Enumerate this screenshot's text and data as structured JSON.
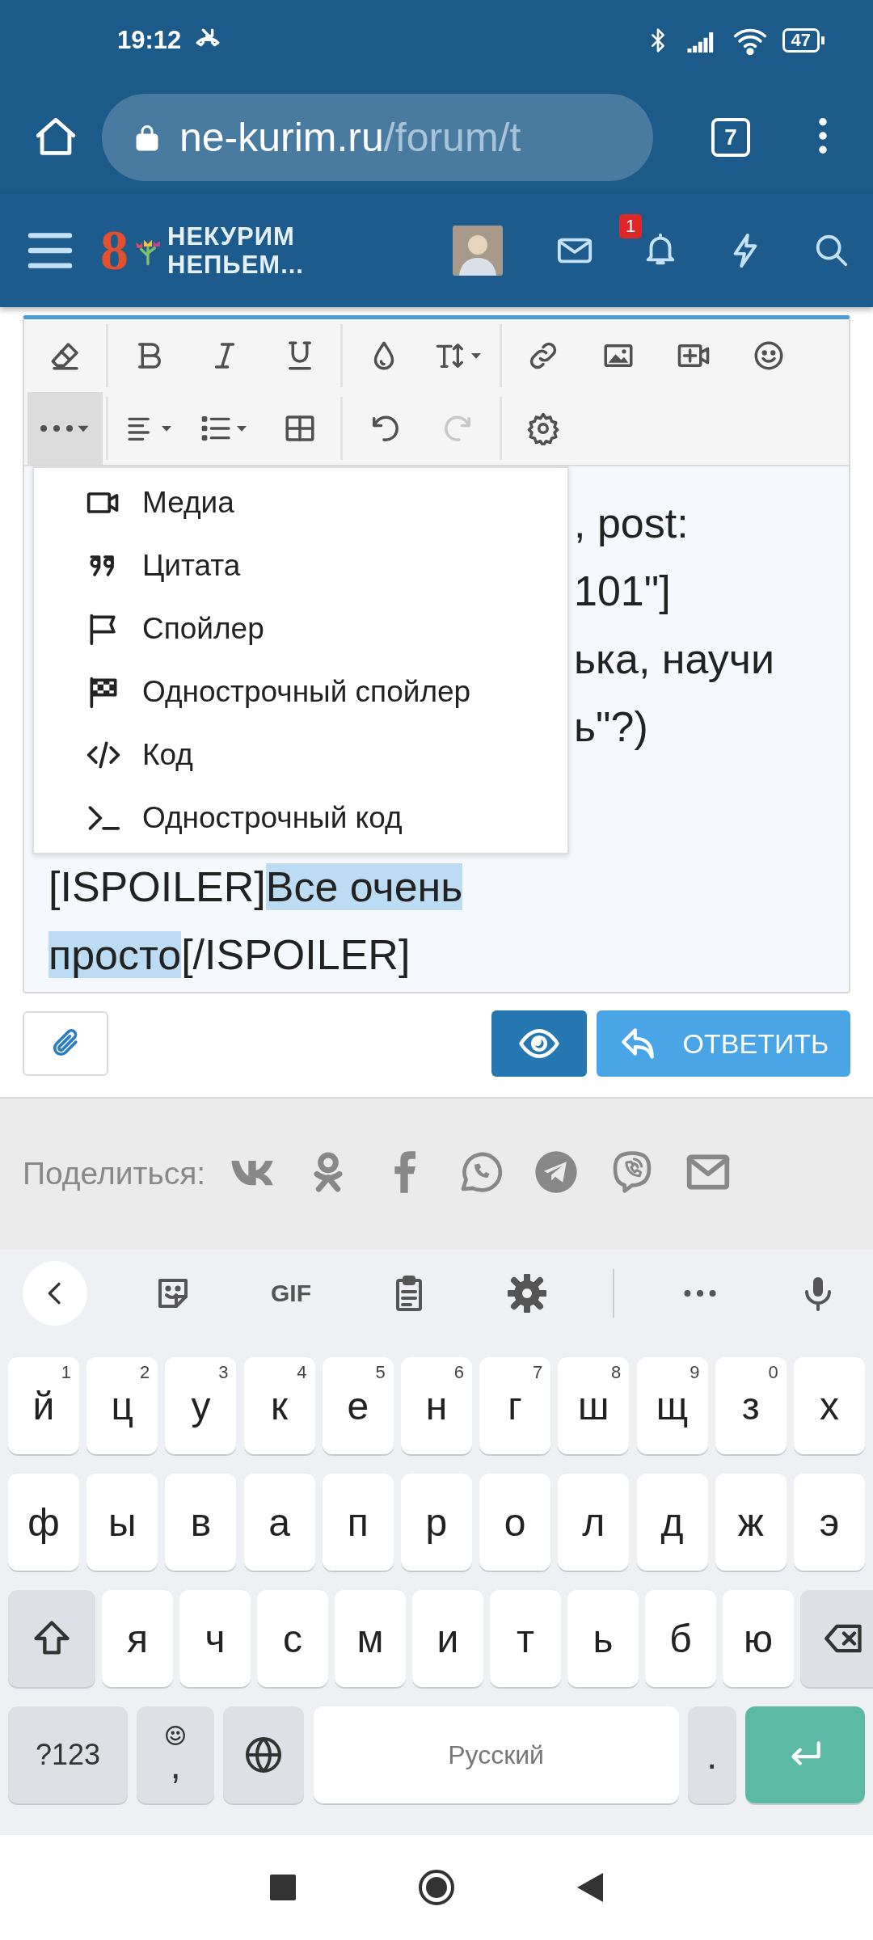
{
  "status_bar": {
    "time": "19:12",
    "battery": "47"
  },
  "browser": {
    "url_host": "ne-kurim.ru",
    "url_path": "/forum/t",
    "tab_count": "7"
  },
  "forum_header": {
    "logo_mark": "8",
    "logo_line1": "НЕКУРИМ",
    "logo_line2": "НЕПЬЕМ...",
    "notification_count": "1"
  },
  "editor": {
    "toolbar": [
      [
        [
          {
            "kind": "eraser",
            "active": false,
            "disabled": false
          }
        ],
        [
          {
            "kind": "bold",
            "active": false,
            "disabled": false
          },
          {
            "kind": "italic",
            "active": false,
            "disabled": false
          },
          {
            "kind": "underline",
            "active": false,
            "disabled": false
          }
        ],
        [
          {
            "kind": "color",
            "active": false,
            "disabled": false
          },
          {
            "kind": "size",
            "active": false,
            "disabled": false
          }
        ],
        [
          {
            "kind": "link",
            "active": false,
            "disabled": false
          },
          {
            "kind": "image",
            "active": false,
            "disabled": false
          },
          {
            "kind": "video",
            "active": false,
            "disabled": false
          },
          {
            "kind": "emoji",
            "active": false,
            "disabled": false
          }
        ]
      ],
      [
        [
          {
            "kind": "more",
            "active": true,
            "disabled": false
          }
        ],
        [
          {
            "kind": "align",
            "active": false,
            "disabled": false
          },
          {
            "kind": "list",
            "active": false,
            "disabled": false
          },
          {
            "kind": "table",
            "active": false,
            "disabled": false
          }
        ],
        [
          {
            "kind": "undo",
            "active": false,
            "disabled": false
          },
          {
            "kind": "redo",
            "active": false,
            "disabled": true
          }
        ],
        [
          {
            "kind": "settings",
            "active": false,
            "disabled": false
          }
        ]
      ]
    ],
    "menu": [
      {
        "kind": "media",
        "label": "Медиа"
      },
      {
        "kind": "quote",
        "label": "Цитата"
      },
      {
        "kind": "spoiler",
        "label": "Спойлер"
      },
      {
        "kind": "inline_spoiler",
        "label": "Однострочный спойлер"
      },
      {
        "kind": "code",
        "label": "Код"
      },
      {
        "kind": "inline_code",
        "label": "Однострочный код"
      }
    ],
    "lines": [
      {
        "kind": "partial",
        "segments": [
          {
            "text": ", post:",
            "selected": false
          }
        ]
      },
      {
        "kind": "partial",
        "segments": [
          {
            "text": "101\"]",
            "selected": false
          }
        ]
      },
      {
        "kind": "partial",
        "segments": [
          {
            "text": "ька, научи",
            "selected": false
          }
        ]
      },
      {
        "kind": "partial",
        "segments": [
          {
            "text": "ь\"?)",
            "selected": false
          }
        ]
      },
      {
        "kind": "full",
        "segments": [
          {
            "text": "[ISPOILER]",
            "selected": false
          },
          {
            "text": "Все очень ",
            "selected": true
          }
        ]
      },
      {
        "kind": "full",
        "segments": [
          {
            "text": "просто",
            "selected": true
          },
          {
            "text": "[/ISPOILER]",
            "selected": false
          }
        ]
      }
    ]
  },
  "actions": {
    "reply_label": "ОТВЕТИТЬ"
  },
  "share": {
    "label": "Поделиться:",
    "icons": [
      {
        "kind": "vk"
      },
      {
        "kind": "ok"
      },
      {
        "kind": "facebook"
      },
      {
        "kind": "whatsapp"
      },
      {
        "kind": "telegram"
      },
      {
        "kind": "viber"
      },
      {
        "kind": "email"
      }
    ]
  },
  "keyboard": {
    "toolbar": [
      {
        "kind": "back"
      },
      {
        "kind": "sticker"
      },
      {
        "kind": "gif",
        "label": "GIF"
      },
      {
        "kind": "clipboard"
      },
      {
        "kind": "settings"
      },
      {
        "kind": "more"
      },
      {
        "kind": "mic"
      }
    ],
    "rows": [
      [
        {
          "kind": "letter",
          "label": "й",
          "hint": "1"
        },
        {
          "kind": "letter",
          "label": "ц",
          "hint": "2"
        },
        {
          "kind": "letter",
          "label": "у",
          "hint": "3"
        },
        {
          "kind": "letter",
          "label": "к",
          "hint": "4"
        },
        {
          "kind": "letter",
          "label": "е",
          "hint": "5"
        },
        {
          "kind": "letter",
          "label": "н",
          "hint": "6"
        },
        {
          "kind": "letter",
          "label": "г",
          "hint": "7"
        },
        {
          "kind": "letter",
          "label": "ш",
          "hint": "8"
        },
        {
          "kind": "letter",
          "label": "щ",
          "hint": "9"
        },
        {
          "kind": "letter",
          "label": "з",
          "hint": "0"
        },
        {
          "kind": "letter",
          "label": "х"
        }
      ],
      [
        {
          "kind": "letter",
          "label": "ф"
        },
        {
          "kind": "letter",
          "label": "ы"
        },
        {
          "kind": "letter",
          "label": "в"
        },
        {
          "kind": "letter",
          "label": "а"
        },
        {
          "kind": "letter",
          "label": "п"
        },
        {
          "kind": "letter",
          "label": "р"
        },
        {
          "kind": "letter",
          "label": "о"
        },
        {
          "kind": "letter",
          "label": "л"
        },
        {
          "kind": "letter",
          "label": "д"
        },
        {
          "kind": "letter",
          "label": "ж"
        },
        {
          "kind": "letter",
          "label": "э"
        }
      ],
      [
        {
          "kind": "shift"
        },
        {
          "kind": "letter",
          "label": "я"
        },
        {
          "kind": "letter",
          "label": "ч"
        },
        {
          "kind": "letter",
          "label": "с"
        },
        {
          "kind": "letter",
          "label": "м"
        },
        {
          "kind": "letter",
          "label": "и"
        },
        {
          "kind": "letter",
          "label": "т"
        },
        {
          "kind": "letter",
          "label": "ь"
        },
        {
          "kind": "letter",
          "label": "б"
        },
        {
          "kind": "letter",
          "label": "ю"
        },
        {
          "kind": "backspace"
        }
      ]
    ],
    "bottom_row": [
      {
        "kind": "symbols",
        "label": "?123"
      },
      {
        "kind": "emoji_comma",
        "label": ","
      },
      {
        "kind": "globe"
      },
      {
        "kind": "space",
        "label": "Русский"
      },
      {
        "kind": "period",
        "label": "."
      },
      {
        "kind": "enter"
      }
    ]
  }
}
